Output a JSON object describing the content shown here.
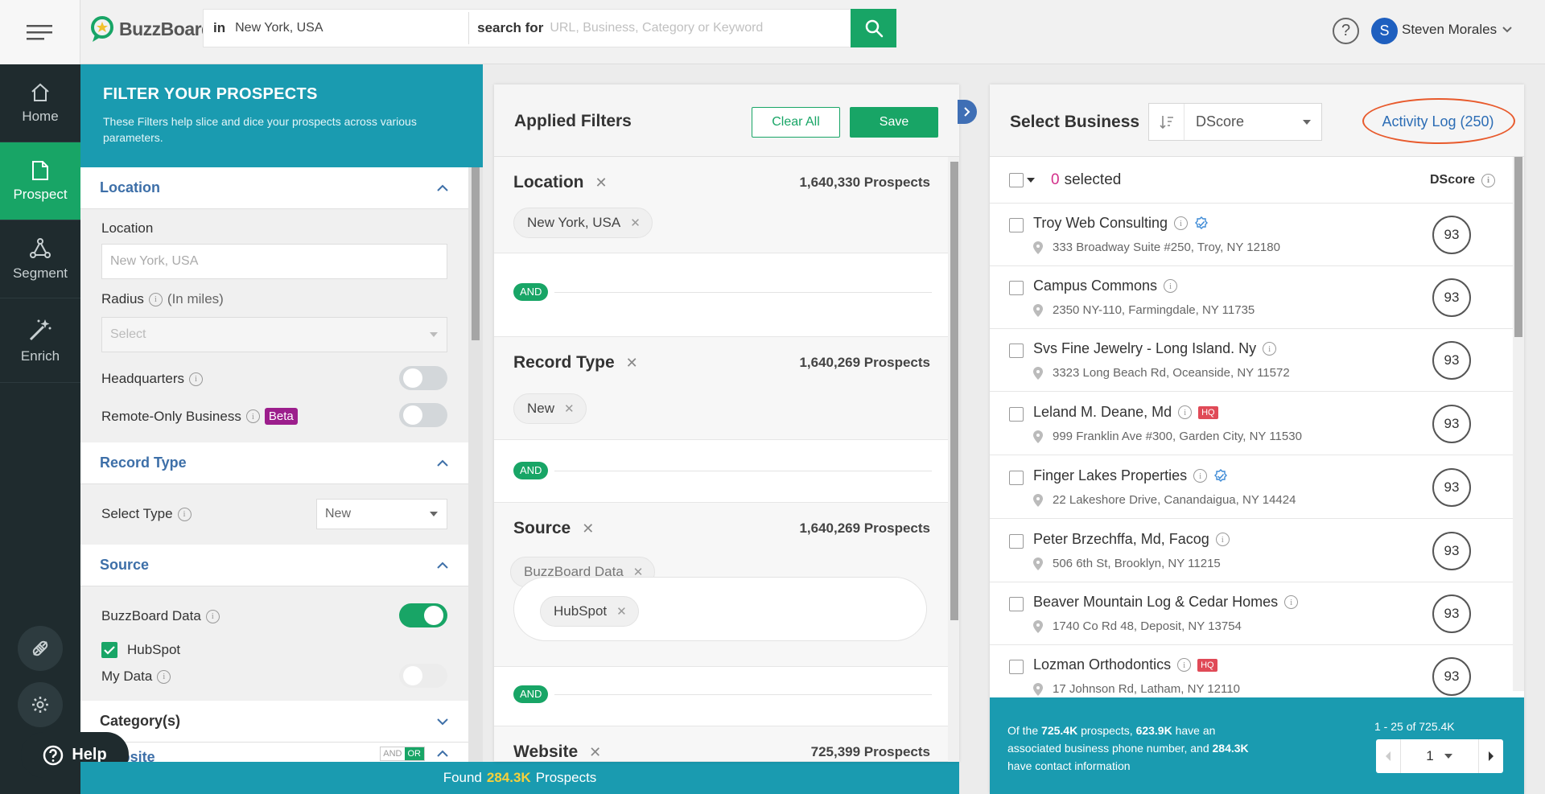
{
  "app": {
    "brand": "BuzzBoard"
  },
  "search": {
    "in_label": "in",
    "location": "New York, USA",
    "search_for_label": "search for",
    "placeholder": "URL, Business, Category or Keyword"
  },
  "user": {
    "initial": "S",
    "name": "Steven Morales"
  },
  "nav": {
    "items": [
      {
        "label": "Home"
      },
      {
        "label": "Prospect"
      },
      {
        "label": "Segment"
      },
      {
        "label": "Enrich"
      }
    ],
    "help_label": "Help"
  },
  "filters": {
    "title": "FILTER YOUR PROSPECTS",
    "subtitle": "These Filters help slice and dice your prospects across various parameters.",
    "location": {
      "heading": "Location",
      "label": "Location",
      "placeholder": "New York, USA",
      "radius_label": "Radius",
      "radius_unit": "(In miles)",
      "radius_placeholder": "Select",
      "hq_label": "Headquarters",
      "remote_label": "Remote-Only Business",
      "beta": "Beta"
    },
    "record_type": {
      "heading": "Record Type",
      "label": "Select Type",
      "value": "New"
    },
    "source": {
      "heading": "Source",
      "buzzboard_label": "BuzzBoard Data",
      "hubspot_label": "HubSpot",
      "mydata_label": "My Data"
    },
    "category_heading": "Category(s)",
    "website_heading": "Website",
    "and_label": "AND",
    "or_label": "OR"
  },
  "found": {
    "prefix": "Found",
    "count": "284.3K",
    "suffix": "Prospects"
  },
  "applied": {
    "title": "Applied Filters",
    "clear_all": "Clear All",
    "save": "Save",
    "and": "AND",
    "sections": [
      {
        "title": "Location",
        "count": "1,640,330 Prospects",
        "chips": [
          "New York, USA"
        ]
      },
      {
        "title": "Record Type",
        "count": "1,640,269 Prospects",
        "chips": [
          "New"
        ]
      },
      {
        "title": "Source",
        "count": "1,640,269 Prospects",
        "chips": [
          "BuzzBoard Data",
          "HubSpot"
        ]
      },
      {
        "title": "Website",
        "count": "725,399 Prospects",
        "chips": []
      }
    ]
  },
  "business": {
    "title": "Select Business",
    "sort": "DScore",
    "activity_log": "Activity Log (250)",
    "selected_count": "0",
    "selected_label": "selected",
    "dscore_label": "DScore",
    "rows": [
      {
        "name": "Troy Web Consulting",
        "address": "333 Broadway Suite #250, Troy, NY 12180",
        "score": "93",
        "verified": true,
        "hq": false
      },
      {
        "name": "Campus Commons",
        "address": "2350 NY-110, Farmingdale, NY 11735",
        "score": "93",
        "verified": false,
        "hq": false
      },
      {
        "name": "Svs Fine Jewelry - Long Island. Ny",
        "address": "3323 Long Beach Rd, Oceanside, NY 11572",
        "score": "93",
        "verified": false,
        "hq": false
      },
      {
        "name": "Leland M. Deane, Md",
        "address": "999 Franklin Ave #300, Garden City, NY 11530",
        "score": "93",
        "verified": false,
        "hq": true
      },
      {
        "name": "Finger Lakes Properties",
        "address": "22 Lakeshore Drive, Canandaigua, NY 14424",
        "score": "93",
        "verified": true,
        "hq": false
      },
      {
        "name": "Peter Brzechffa, Md, Facog",
        "address": "506 6th St, Brooklyn, NY 11215",
        "score": "93",
        "verified": false,
        "hq": false
      },
      {
        "name": "Beaver Mountain Log & Cedar Homes",
        "address": "1740 Co Rd 48, Deposit, NY 13754",
        "score": "93",
        "verified": false,
        "hq": false
      },
      {
        "name": "Lozman Orthodontics",
        "address": "17 Johnson Rd, Latham, NY 12110",
        "score": "93",
        "verified": false,
        "hq": true
      }
    ],
    "hq_label": "HQ",
    "footer": {
      "s1": "Of the",
      "total": "725.4K",
      "s2": "prospects,",
      "phone": "623.9K",
      "s3": "have an associated business phone number, and",
      "contact": "284.3K",
      "s4": "have contact information",
      "range": "1 - 25 of 725.4K",
      "page": "1"
    }
  },
  "colors": {
    "green": "#18a566",
    "teal": "#1a9bb0",
    "blue_link": "#2c6db5",
    "dark_nav": "#1f2b2e",
    "hq_red": "#e04a57",
    "highlight_ring": "#e85a2c"
  }
}
